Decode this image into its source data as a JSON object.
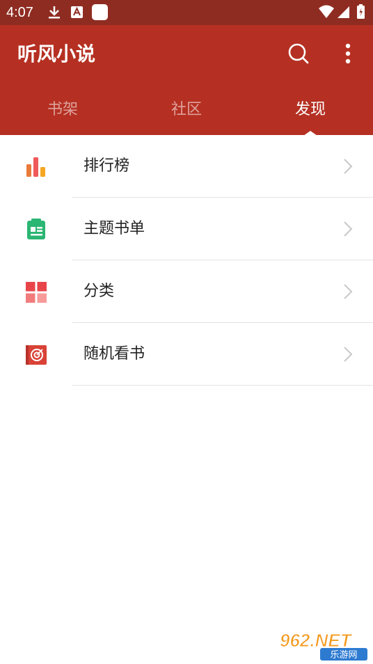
{
  "status_bar": {
    "time": "4:07"
  },
  "app_bar": {
    "title": "听风小说"
  },
  "tabs": [
    {
      "label": "书架",
      "active": false
    },
    {
      "label": "社区",
      "active": false
    },
    {
      "label": "发现",
      "active": true
    }
  ],
  "list": [
    {
      "label": "排行榜",
      "icon": "ranking-bar-chart-icon"
    },
    {
      "label": "主题书单",
      "icon": "book-list-icon"
    },
    {
      "label": "分类",
      "icon": "category-grid-icon"
    },
    {
      "label": "随机看书",
      "icon": "random-target-icon"
    }
  ],
  "watermark": {
    "text": "962.NET",
    "subtext": "乐游网"
  },
  "colors": {
    "status_bar": "#8f2c22",
    "app_bar": "#b53022",
    "ranking_orange": "#e97a3a",
    "booklist_green": "#2bb673",
    "category_red": "#f0595a",
    "random_red": "#d94236"
  }
}
